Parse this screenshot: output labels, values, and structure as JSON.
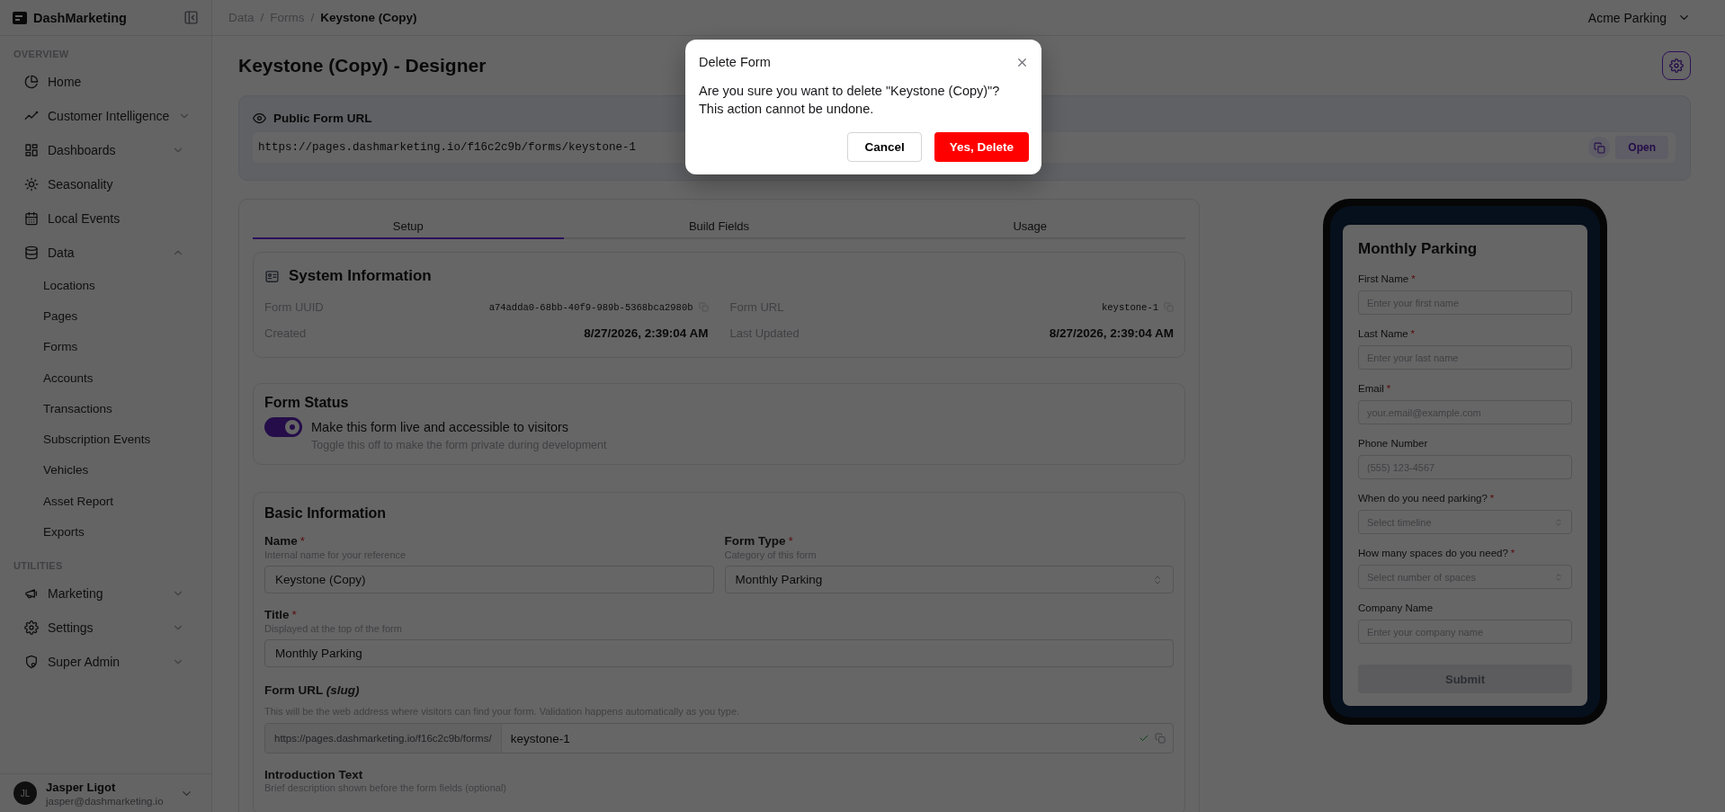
{
  "sidebar": {
    "brand": "DashMarketing",
    "sections": [
      {
        "heading": "OVERVIEW",
        "items": [
          {
            "label": "Home",
            "kind": "link"
          },
          {
            "label": "Customer Intelligence",
            "kind": "group",
            "expanded": false
          },
          {
            "label": "Dashboards",
            "kind": "group",
            "expanded": false
          },
          {
            "label": "Seasonality",
            "kind": "link"
          },
          {
            "label": "Local Events",
            "kind": "link"
          },
          {
            "label": "Data",
            "kind": "group",
            "expanded": true,
            "children": [
              {
                "label": "Locations"
              },
              {
                "label": "Pages"
              },
              {
                "label": "Forms"
              },
              {
                "label": "Accounts"
              },
              {
                "label": "Transactions"
              },
              {
                "label": "Subscription Events"
              },
              {
                "label": "Vehicles"
              },
              {
                "label": "Asset Report"
              },
              {
                "label": "Exports"
              }
            ]
          }
        ]
      },
      {
        "heading": "UTILITIES",
        "items": [
          {
            "label": "Marketing",
            "kind": "group",
            "expanded": false
          },
          {
            "label": "Settings",
            "kind": "group",
            "expanded": false
          },
          {
            "label": "Super Admin",
            "kind": "group",
            "expanded": false
          }
        ]
      }
    ],
    "user": {
      "initials": "JL",
      "name": "Jasper Ligot",
      "email": "jasper@dashmarketing.io"
    }
  },
  "header": {
    "breadcrumbs": [
      {
        "label": "Data",
        "current": false
      },
      {
        "label": "Forms",
        "current": false
      },
      {
        "label": "Keystone (Copy)",
        "current": true
      }
    ],
    "separators": [
      "/",
      "/"
    ],
    "account": "Acme Parking"
  },
  "page": {
    "title": "Keystone (Copy) - Designer",
    "public_url": {
      "label": "Public Form URL",
      "url": "https://pages.dashmarketing.io/f16c2c9b/forms/keystone-1",
      "open_button": "Open"
    }
  },
  "tabs": [
    {
      "label": "Setup",
      "selected": true
    },
    {
      "label": "Build Fields",
      "selected": false
    },
    {
      "label": "Usage",
      "selected": false
    }
  ],
  "system_info": {
    "title": "System Information",
    "fields": [
      {
        "label": "Form UUID",
        "value": "a74adda0-68bb-40f9-989b-5368bca2980b",
        "kind": "code"
      },
      {
        "label": "Form URL",
        "value": "keystone-1",
        "kind": "code"
      },
      {
        "label": "Created",
        "value": "8/27/2026, 2:39:04 AM",
        "kind": "date"
      },
      {
        "label": "Last Updated",
        "value": "8/27/2026, 2:39:04 AM",
        "kind": "date"
      }
    ]
  },
  "form_status": {
    "title": "Form Status",
    "on": true,
    "label": "Make this form live and accessible to visitors",
    "hint": "Toggle this off to make the form private during development"
  },
  "basic_info": {
    "title": "Basic Information",
    "fields": [
      {
        "kind": "text",
        "label": "Name",
        "required_mark": "*",
        "hint": "Internal name for your reference",
        "value": "Keystone (Copy)"
      },
      {
        "kind": "select",
        "label": "Form Type",
        "required_mark": "*",
        "hint": "Category of this form",
        "value": "Monthly Parking"
      },
      {
        "kind": "text",
        "label": "Title",
        "required_mark": "*",
        "hint": "Displayed at the top of the form",
        "value": "Monthly Parking"
      }
    ],
    "slug": {
      "label": "Form URL *(slug)*",
      "hint": "This will be the web address where visitors can find your form. Validation happens automatically as you type.",
      "prefix": "https://pages.dashmarketing.io/f16c2c9b/forms/",
      "value": "keystone-1",
      "valid": true
    },
    "intro": {
      "label": "Introduction Text",
      "hint": "Brief description shown before the form fields (optional)"
    }
  },
  "preview": {
    "title": "Monthly Parking",
    "fields": [
      {
        "kind": "input",
        "label": "First Name",
        "required_mark": "*",
        "placeholder": "Enter your first name"
      },
      {
        "kind": "input",
        "label": "Last Name",
        "required_mark": "*",
        "placeholder": "Enter your last name"
      },
      {
        "kind": "input",
        "label": "Email",
        "required_mark": "*",
        "placeholder": "your.email@example.com"
      },
      {
        "kind": "input",
        "label": "Phone Number",
        "placeholder": "(555) 123-4567"
      },
      {
        "kind": "select",
        "label": "When do you need parking?",
        "required_mark": "*",
        "placeholder": "Select timeline"
      },
      {
        "kind": "select",
        "label": "How many spaces do you need?",
        "required_mark": "*",
        "placeholder": "Select number of spaces"
      },
      {
        "kind": "input",
        "label": "Company Name",
        "placeholder": "Enter your company name"
      }
    ],
    "submit": {
      "label": "Submit",
      "disabled": true
    }
  },
  "dialog": {
    "title": "Delete Form",
    "message": [
      "Are you sure you want to delete \"Keystone (Copy)\"?",
      "This action cannot be undone."
    ],
    "cancel": "Cancel",
    "confirm": "Yes, Delete"
  }
}
